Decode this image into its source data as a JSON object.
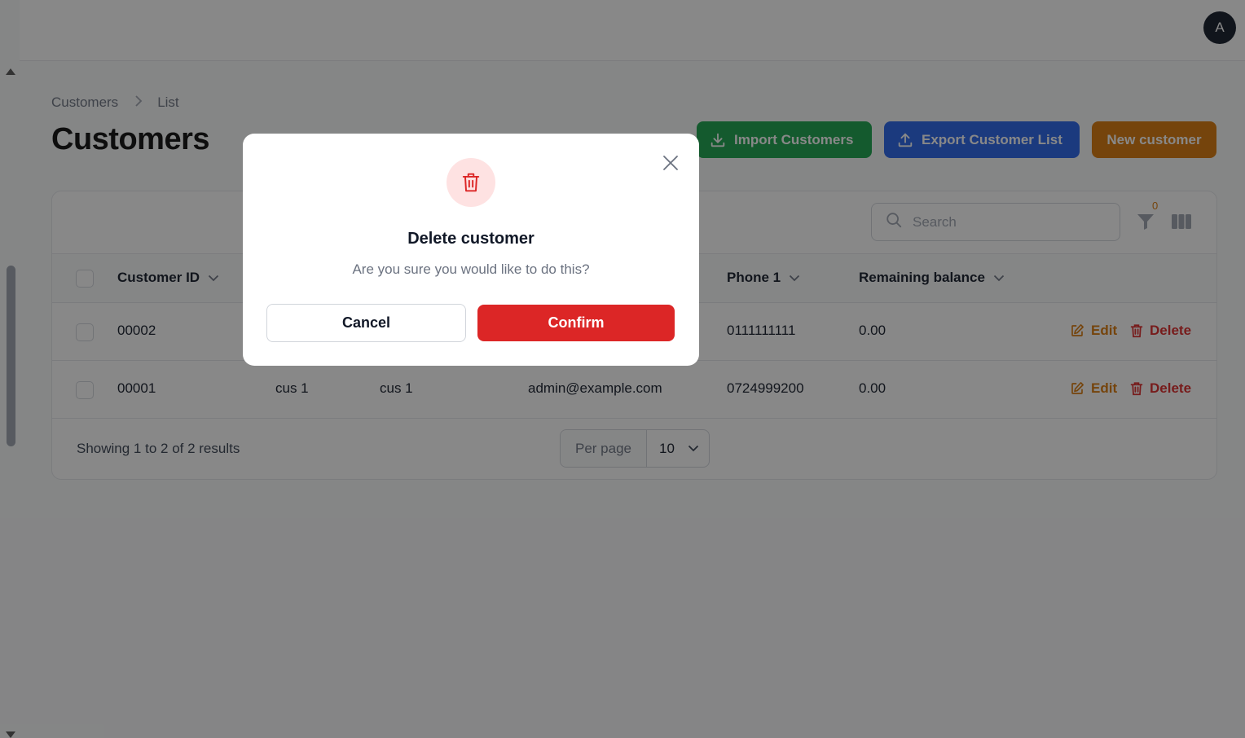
{
  "header": {
    "avatar_initial": "A"
  },
  "breadcrumb": {
    "root": "Customers",
    "current": "List"
  },
  "page": {
    "title": "Customers"
  },
  "actions": {
    "import_label": "Import Customers",
    "export_label": "Export Customer List",
    "new_label": "New customer"
  },
  "table": {
    "search_placeholder": "Search",
    "filter_count": "0",
    "columns": {
      "customer_id": "Customer ID",
      "phone": "Phone 1",
      "balance": "Remaining balance"
    },
    "rows": [
      {
        "id": "00002",
        "first": "",
        "last": "",
        "email": "",
        "phone": "0111111111",
        "balance": "0.00"
      },
      {
        "id": "00001",
        "first": "cus 1",
        "last": "cus 1",
        "email": "admin@example.com",
        "phone": "0724999200",
        "balance": "0.00"
      }
    ],
    "edit_label": "Edit",
    "delete_label": "Delete",
    "summary": "Showing 1 to 2 of 2 results",
    "per_page_label": "Per page",
    "per_page_value": "10"
  },
  "modal": {
    "title": "Delete customer",
    "message": "Are you sure you would like to do this?",
    "cancel_label": "Cancel",
    "confirm_label": "Confirm"
  },
  "colors": {
    "import": "#16a34a",
    "export": "#2563eb",
    "new": "#d97706",
    "danger": "#dc2626",
    "edit": "#d97706"
  }
}
